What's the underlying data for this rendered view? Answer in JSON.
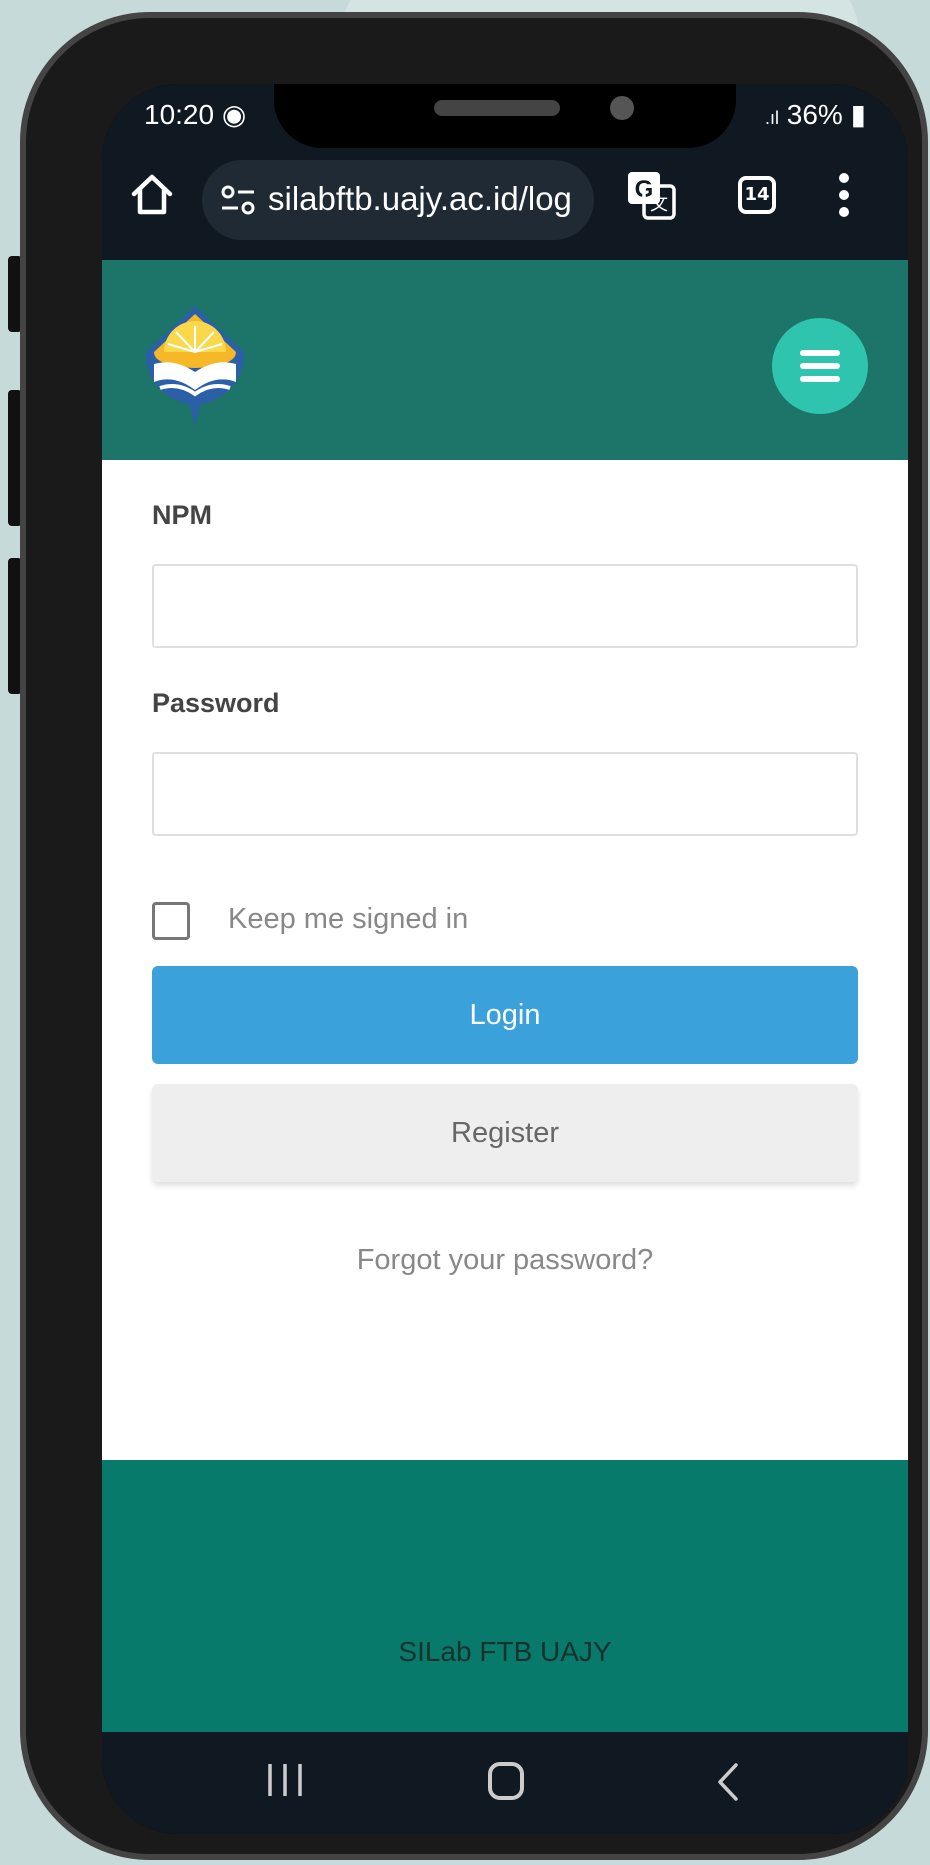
{
  "status_bar": {
    "time": "10:20",
    "battery": "36%"
  },
  "browser": {
    "url": "silabftb.uajy.ac.id/log",
    "tab_count": "14"
  },
  "form": {
    "npm_label": "NPM",
    "npm_value": "",
    "password_label": "Password",
    "password_value": "",
    "keep_signed_in_label": "Keep me signed in",
    "keep_signed_in_checked": false,
    "login_label": "Login",
    "register_label": "Register",
    "forgot_label": "Forgot your password?"
  },
  "footer": {
    "text": "SILab FTB UAJY"
  },
  "colors": {
    "header": "#1d7468",
    "menu_button": "#2ec4ad",
    "login_button": "#3ba1da",
    "footer": "#087a6c"
  }
}
